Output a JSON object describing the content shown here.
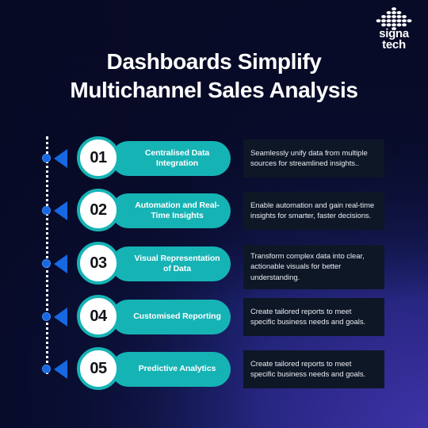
{
  "brand": {
    "logo_mark": "dot-pyramid-icon",
    "name_line1": "signa",
    "name_line2": "tech"
  },
  "header": {
    "title_line1": "Dashboards Simplify",
    "title_line2": "Multichannel Sales Analysis"
  },
  "colors": {
    "accent_teal": "#16b3b5",
    "accent_blue": "#1668e3",
    "desc_panel": "#0e1726",
    "bg_dark": "#080b26",
    "bg_purple": "#3d33a6",
    "text_light": "#ffffff"
  },
  "steps": [
    {
      "number": "01",
      "label": "Centralised Data Integration",
      "description": "Seamlessly unify data from multiple sources for streamlined insights.."
    },
    {
      "number": "02",
      "label": "Automation and Real-Time Insights",
      "description": "Enable automation and gain real-time insights for smarter, faster decisions."
    },
    {
      "number": "03",
      "label": "Visual Representation of Data",
      "description": "Transform complex data into clear, actionable visuals for better understanding."
    },
    {
      "number": "04",
      "label": "Customised Reporting",
      "description": "Create tailored reports to meet specific business needs and goals."
    },
    {
      "number": "05",
      "label": "Predictive Analytics",
      "description": "Create tailored reports to meet specific business needs and goals."
    }
  ]
}
